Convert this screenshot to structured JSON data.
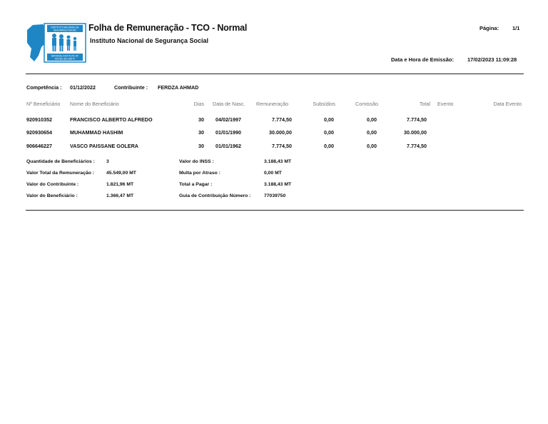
{
  "header": {
    "title": "Folha de Remuneração - TCO - Normal",
    "subtitle": "Instituto Nacional de Segurança Social",
    "page_label": "Página:",
    "page_value": "1/1",
    "emission_label": "Data e Hora de Emissão:",
    "emission_value": "17/02/2023 11:09:28"
  },
  "logo": {
    "top_text_1": "INSTITUTO NACIONAL DE",
    "top_text_2": "SEGURANÇA SOCIAL",
    "bottom_text_1": "NATIONAL INSTITUTE OF",
    "bottom_text_2": "SOCIAL SECURITY",
    "accent_color": "#1f86c6"
  },
  "competencia": {
    "label": "Competência :",
    "value": "01/12/2022",
    "contribuinte_label": "Contribuinte :",
    "contribuinte_value": "FERDZA AHMAD"
  },
  "table": {
    "headers": {
      "num": "Nº Beneficiário",
      "nome": "Nome do Beneficiário",
      "dias": "Dias",
      "nasc": "Data de Nasc.",
      "rem": "Remuneração",
      "subs": "Subsídios",
      "com": "Comissão",
      "total": "Total",
      "evento": "Evento",
      "data_evento": "Data Evento"
    },
    "rows": [
      {
        "num": "920910352",
        "nome": "FRANCISCO ALBERTO ALFREDO",
        "dias": "30",
        "nasc": "04/02/1997",
        "rem": "7.774,50",
        "subs": "0,00",
        "com": "0,00",
        "total": "7.774,50"
      },
      {
        "num": "920930654",
        "nome": "MUHAMMAD HASHIM",
        "dias": "30",
        "nasc": "01/01/1990",
        "rem": "30.000,00",
        "subs": "0,00",
        "com": "0,00",
        "total": "30.000,00"
      },
      {
        "num": "906646227",
        "nome": "VASCO PAISSANE GOLERA",
        "dias": "30",
        "nasc": "01/01/1962",
        "rem": "7.774,50",
        "subs": "0,00",
        "com": "0,00",
        "total": "7.774,50"
      }
    ]
  },
  "summary": {
    "qtd_label": "Quantidade de Beneficiários :",
    "qtd_value": "3",
    "vtr_label": "Valor Total da Remuneração :",
    "vtr_value": "45.549,00 MT",
    "vc_label": "Valor do Contribuinte :",
    "vc_value": "1.821,96 MT",
    "vb_label": "Valor do Beneficiário :",
    "vb_value": "1.366,47 MT",
    "inss_label": "Valor do INSS :",
    "inss_value": "3.188,43 MT",
    "multa_label": "Multa por Atraso :",
    "multa_value": "0,00 MT",
    "tp_label": "Total a Pagar :",
    "tp_value": "3.188,43 MT",
    "guia_label": "Guia de Contribuição Número :",
    "guia_value": "77039750"
  }
}
